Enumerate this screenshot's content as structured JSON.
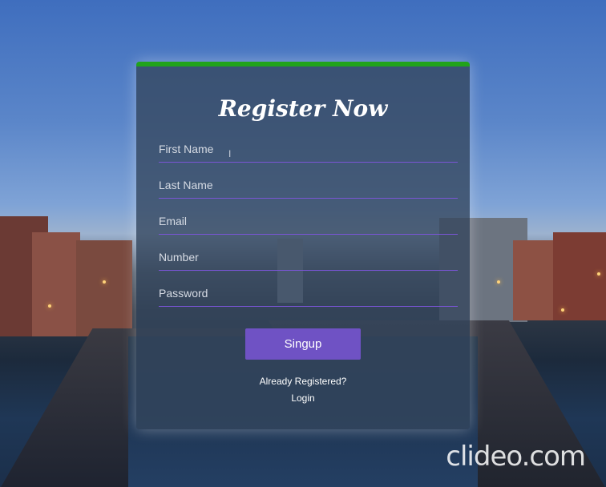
{
  "form": {
    "title": "Register Now",
    "fields": [
      {
        "placeholder": "First Name",
        "value": ""
      },
      {
        "placeholder": "Last Name",
        "value": ""
      },
      {
        "placeholder": "Email",
        "value": ""
      },
      {
        "placeholder": "Number",
        "value": ""
      },
      {
        "placeholder": "Password",
        "value": ""
      }
    ],
    "submit_label": "Singup",
    "already_text": "Already Registered?",
    "login_label": "Login"
  },
  "watermark": "clideo.com",
  "colors": {
    "accent_top_border": "#21a31b",
    "button": "#6f52c4",
    "field_underline": "#7a55d6",
    "card_bg": "#34465e"
  }
}
